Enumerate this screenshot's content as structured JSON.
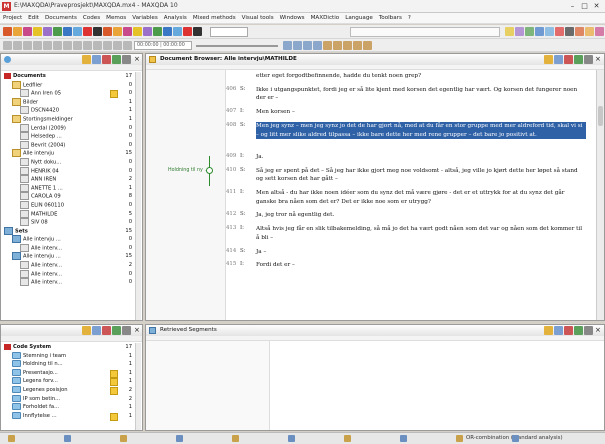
{
  "window": {
    "title": "E:\\MAXQDA\\Praveprosjekt\\MAXQDA.mx4 - MAXQDA 10",
    "logo_text": "M"
  },
  "menu": [
    "Project",
    "Edit",
    "Documents",
    "Codes",
    "Memos",
    "Variables",
    "Analysis",
    "Mixed methods",
    "Visual tools",
    "Windows",
    "MAXDictio",
    "Language",
    "Toolbars",
    "?"
  ],
  "toolbar": {
    "time_display": "00:00:00 | 00:00:00",
    "colors": [
      "#d85a2b",
      "#e9a53a",
      "#c94a8a",
      "#e6c229",
      "#9a70c8",
      "#4d9c4b",
      "#3a78c6",
      "#66aadd",
      "#d33",
      "#333"
    ]
  },
  "doc_system": {
    "title": "Documents",
    "title_count": "17",
    "rows": [
      {
        "label": "Documents",
        "count": "17",
        "level": 0,
        "icon": "red",
        "bold": true
      },
      {
        "label": "Ledfiler",
        "count": "0",
        "level": 1,
        "icon": "grp"
      },
      {
        "label": "Ann Iren 05",
        "count": "0",
        "level": 2,
        "icon": "doc",
        "memo": true
      },
      {
        "label": "Bilder",
        "count": "1",
        "level": 1,
        "icon": "grp"
      },
      {
        "label": "DSCN4420",
        "count": "1",
        "level": 2,
        "icon": "doc"
      },
      {
        "label": "Stortingsmeldinger",
        "count": "1",
        "level": 1,
        "icon": "grp"
      },
      {
        "label": "Lerdal (2009)",
        "count": "0",
        "level": 2,
        "icon": "doc"
      },
      {
        "label": "Helsedep ...",
        "count": "0",
        "level": 2,
        "icon": "doc"
      },
      {
        "label": "Bevrit (2004)",
        "count": "0",
        "level": 2,
        "icon": "doc"
      },
      {
        "label": "Alle intervju",
        "count": "15",
        "level": 1,
        "icon": "grp"
      },
      {
        "label": "Nytt doku...",
        "count": "0",
        "level": 2,
        "icon": "doc"
      },
      {
        "label": "HENRIK 04",
        "count": "0",
        "level": 2,
        "icon": "doc"
      },
      {
        "label": "ANN IREN",
        "count": "2",
        "level": 2,
        "icon": "doc"
      },
      {
        "label": "ANETTE 1 ...",
        "count": "1",
        "level": 2,
        "icon": "doc"
      },
      {
        "label": "CAROLA 09",
        "count": "8",
        "level": 2,
        "icon": "doc"
      },
      {
        "label": "ELIN 060110",
        "count": "0",
        "level": 2,
        "icon": "doc"
      },
      {
        "label": "MATHILDE",
        "count": "5",
        "level": 2,
        "icon": "doc"
      },
      {
        "label": "SIV 08",
        "count": "0",
        "level": 2,
        "icon": "doc"
      },
      {
        "label": "Sets",
        "count": "15",
        "level": 0,
        "icon": "set",
        "bold": true
      },
      {
        "label": "Alle intervju ...",
        "count": "0",
        "level": 1,
        "icon": "set"
      },
      {
        "label": "Alle interv...",
        "count": "0",
        "level": 2,
        "icon": "doc"
      },
      {
        "label": "Alle intervju ...",
        "count": "15",
        "level": 1,
        "icon": "set"
      },
      {
        "label": "Alle interv...",
        "count": "2",
        "level": 2,
        "icon": "doc"
      },
      {
        "label": "Alle interv...",
        "count": "0",
        "level": 2,
        "icon": "doc"
      },
      {
        "label": "Alle interv...",
        "count": "0",
        "level": 2,
        "icon": "doc"
      }
    ]
  },
  "doc_browser": {
    "title": "Document Browser: Alle intervju\\MATHILDE",
    "code_label": "Holdning til ny ...",
    "paragraphs": [
      {
        "num": "",
        "speaker": "",
        "text": "etter eget forgodtbefinnende, hadde du tenkt noen grep?",
        "hl": false
      },
      {
        "num": "406",
        "speaker": "S:",
        "text": "Ikke i utgangspunktet, fordi jeg er så lite kjent med korsen det egentlig har vært. Og korsen det fungerer noen der er –",
        "hl": false
      },
      {
        "num": "407",
        "speaker": "I:",
        "text": "Men korsen –",
        "hl": false
      },
      {
        "num": "408",
        "speaker": "S:",
        "text": "Men jeg synz – men jeg synz jo det de har gjort nå, med at du får en stor gruppe med mer aldreford tid, skal vi si – og litt mer slike aldred tilpassa – ikke bare dette her med rene grupper – det bare jo positivt at.",
        "hl": true
      },
      {
        "num": "409",
        "speaker": "I:",
        "text": "Ja.",
        "hl": false
      },
      {
        "num": "410",
        "speaker": "S:",
        "text": "Så jeg er spent på det – Så jeg har ikke gjort meg noe voldsomt - altså, jeg ville jo kjørt dette her løpet så stand og sett korsen det har gått –",
        "hl": false
      },
      {
        "num": "411",
        "speaker": "I:",
        "text": "Men altså - du har ikke noen idéer som du synz det må være gjøre - det er et uttrykk for at du synz det går ganske bra nåen som det er? Det er ikke noe som er utrygg?",
        "hl": false
      },
      {
        "num": "412",
        "speaker": "S:",
        "text": "Ja, jeg tror nå egentlig det.",
        "hl": false
      },
      {
        "num": "413",
        "speaker": "I:",
        "text": "Altså hvis jeg får en slik tilbakemelding, så må jo det ha vært godt nåen som det var og nåen som det kommer til å bli –",
        "hl": false
      },
      {
        "num": "414",
        "speaker": "S:",
        "text": "Ja –",
        "hl": false
      },
      {
        "num": "415",
        "speaker": "I:",
        "text": "Fordi det er –",
        "hl": false
      }
    ]
  },
  "code_system": {
    "title": "Code System",
    "title_count": "17",
    "rows": [
      {
        "label": "Code System",
        "count": "17",
        "level": 0,
        "icon": "red",
        "bold": true
      },
      {
        "label": "Stemning i team",
        "count": "1",
        "level": 1,
        "icon": "code"
      },
      {
        "label": "Holdning til n...",
        "count": "1",
        "level": 1,
        "icon": "code"
      },
      {
        "label": "Presentasjo...",
        "count": "1",
        "level": 1,
        "icon": "code",
        "memo": true
      },
      {
        "label": "Legens forv...",
        "count": "1",
        "level": 1,
        "icon": "code",
        "memo": true
      },
      {
        "label": "Legenes posisjon",
        "count": "2",
        "level": 1,
        "icon": "code",
        "memo": true
      },
      {
        "label": "IP som betin...",
        "count": "2",
        "level": 1,
        "icon": "code"
      },
      {
        "label": "Forholdet fa...",
        "count": "1",
        "level": 1,
        "icon": "code"
      },
      {
        "label": "Innflytelse ...",
        "count": "1",
        "level": 1,
        "icon": "code",
        "memo": true
      }
    ]
  },
  "retrieved": {
    "title": "Retrieved Segments"
  },
  "status": {
    "items": [
      "",
      "",
      "",
      "",
      "",
      "",
      "",
      "",
      "OR-combination (standard analysis)",
      ""
    ]
  }
}
